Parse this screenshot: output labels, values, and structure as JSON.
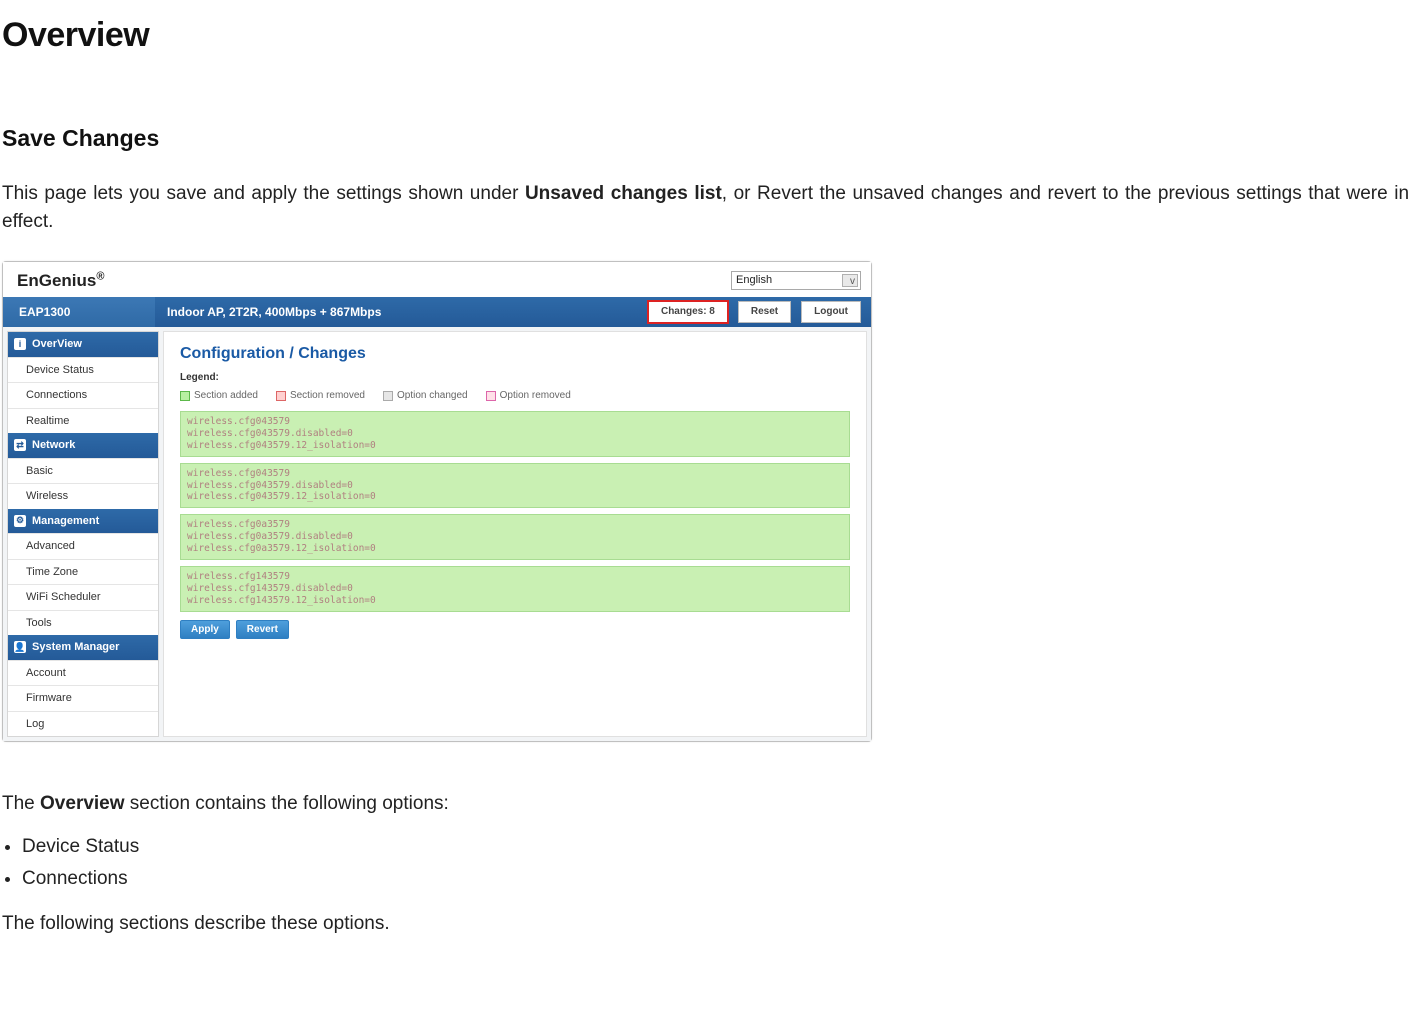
{
  "title": "Overview",
  "subsection": "Save Changes",
  "intro": {
    "pre": "This page lets you save and apply the settings shown under ",
    "bold": "Unsaved changes list",
    "post": ", or Revert the unsaved changes and revert to the previous settings that were in effect."
  },
  "screenshot": {
    "brand": "EnGenius",
    "brand_reg": "®",
    "language": "English",
    "model": "EAP1300",
    "description": "Indoor AP, 2T2R, 400Mbps + 867Mbps",
    "buttons": {
      "changes": "Changes: 8",
      "reset": "Reset",
      "logout": "Logout"
    },
    "nav": {
      "overview": {
        "label": "OverView",
        "items": [
          "Device Status",
          "Connections",
          "Realtime"
        ]
      },
      "network": {
        "label": "Network",
        "items": [
          "Basic",
          "Wireless"
        ]
      },
      "management": {
        "label": "Management",
        "items": [
          "Advanced",
          "Time Zone",
          "WiFi Scheduler",
          "Tools"
        ]
      },
      "system": {
        "label": "System Manager",
        "items": [
          "Account",
          "Firmware",
          "Log"
        ]
      }
    },
    "content": {
      "title": "Configuration / Changes",
      "legend_label": "Legend:",
      "legend": {
        "added": "Section added",
        "removed": "Section removed",
        "opt_changed": "Option changed",
        "opt_removed": "Option removed"
      },
      "blocks": [
        "wireless.cfg043579\nwireless.cfg043579.disabled=0\nwireless.cfg043579.12_isolation=0",
        "wireless.cfg043579\nwireless.cfg043579.disabled=0\nwireless.cfg043579.12_isolation=0",
        "wireless.cfg0a3579\nwireless.cfg0a3579.disabled=0\nwireless.cfg0a3579.12_isolation=0",
        "wireless.cfg143579\nwireless.cfg143579.disabled=0\nwireless.cfg143579.12_isolation=0"
      ],
      "apply": "Apply",
      "revert": "Revert"
    }
  },
  "below": {
    "pre": "The ",
    "bold": "Overview",
    "post": " section contains the following options:"
  },
  "bullets": [
    "Device Status",
    "Connections"
  ],
  "closing": "The following sections describe these options."
}
